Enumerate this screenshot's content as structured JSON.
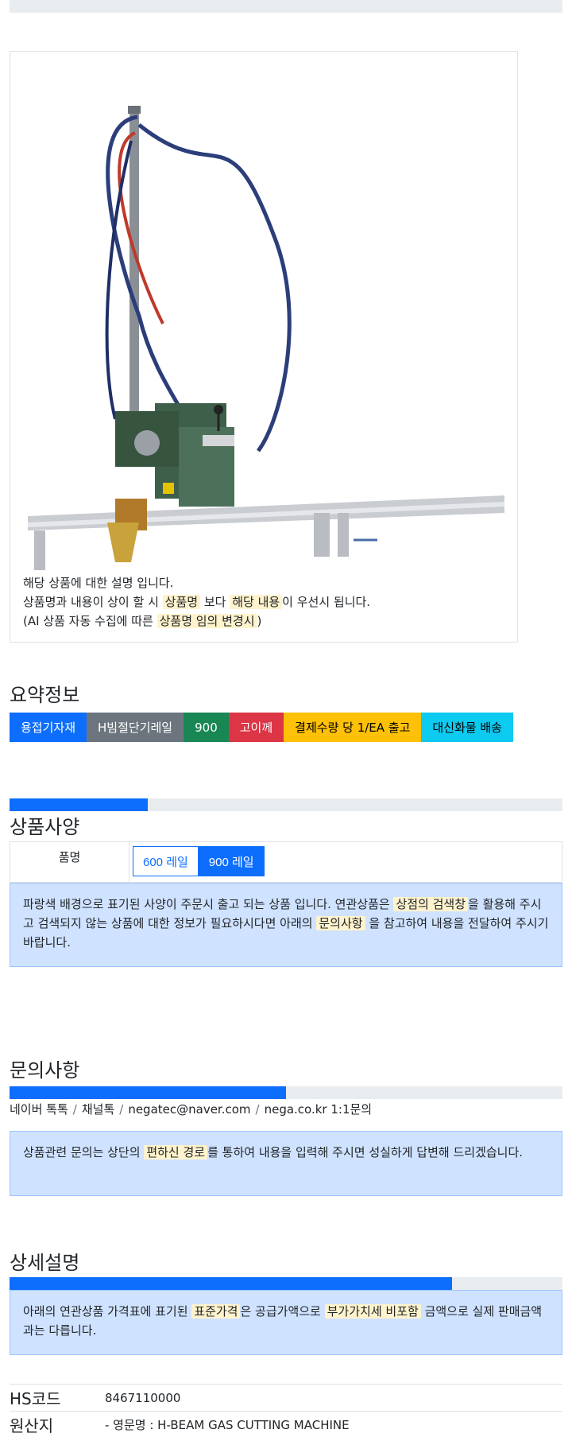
{
  "product": {
    "image_alt": "H-BEAM GAS CUTTING MACHINE",
    "description": {
      "line1": "해당 상품에 대한 설명 입니다.",
      "line2_a": "상품명과 내용이 상이 할 시 ",
      "line2_mark1": "상품명",
      "line2_b": " 보다 ",
      "line2_mark2": "해당 내용",
      "line2_c": "이 우선시 됩니다.",
      "line3_a": "(AI 상품 자동 수집에 따른 ",
      "line3_mark": "상품명 임의 변경시",
      "line3_b": ")"
    }
  },
  "summary": {
    "title": "요약정보",
    "badges": [
      "용접기자재",
      "H빔절단기레일",
      "900",
      "고이께",
      "결제수량 당 1/EA 출고",
      "대신화물 배송"
    ]
  },
  "spec": {
    "title": "상품사양",
    "progress": 0.25,
    "row_header": "품명",
    "options": [
      "600 레일",
      "900 레일"
    ],
    "selected_option": "900 레일",
    "alert_a": "파랑색 배경으로 표기된 사양이 주문시 출고 되는 상품 입니다. 연관상품은 ",
    "alert_mark1": "상점의 검색창",
    "alert_b": "을 활용해 주시고 검색되지 않는 상품에 대한 정보가 필요하시다면 아래의 ",
    "alert_mark2": "문의사항",
    "alert_c": " 을 참고하여 내용을 전달하여 주시기 바랍니다."
  },
  "inquiry": {
    "title": "문의사항",
    "progress": 0.5,
    "links": [
      "네이버 톡톡",
      "채널톡",
      "negatec@naver.com",
      "nega.co.kr 1:1문의"
    ],
    "alert_a": "상품관련 문의는 상단의 ",
    "alert_mark": "편하신 경로",
    "alert_b": "를 통하여 내용을 입력해 주시면 성실하게 답변해 드리겠습니다."
  },
  "detail": {
    "title": "상세설명",
    "progress": 0.8,
    "alert_a": "아래의 연관상품 가격표에 표기된 ",
    "alert_mark1": "표준가격",
    "alert_b": "은 공급가액으로 ",
    "alert_mark2": "부가가치세 비포함",
    "alert_c": " 금액으로 실제 판매금액과는 다릅니다."
  },
  "info": {
    "hs_label": "HS코드",
    "hs_value": "8467110000",
    "origin_label": "원산지",
    "origin_value": "- 영문명 : H-BEAM GAS CUTTING MACHINE"
  }
}
